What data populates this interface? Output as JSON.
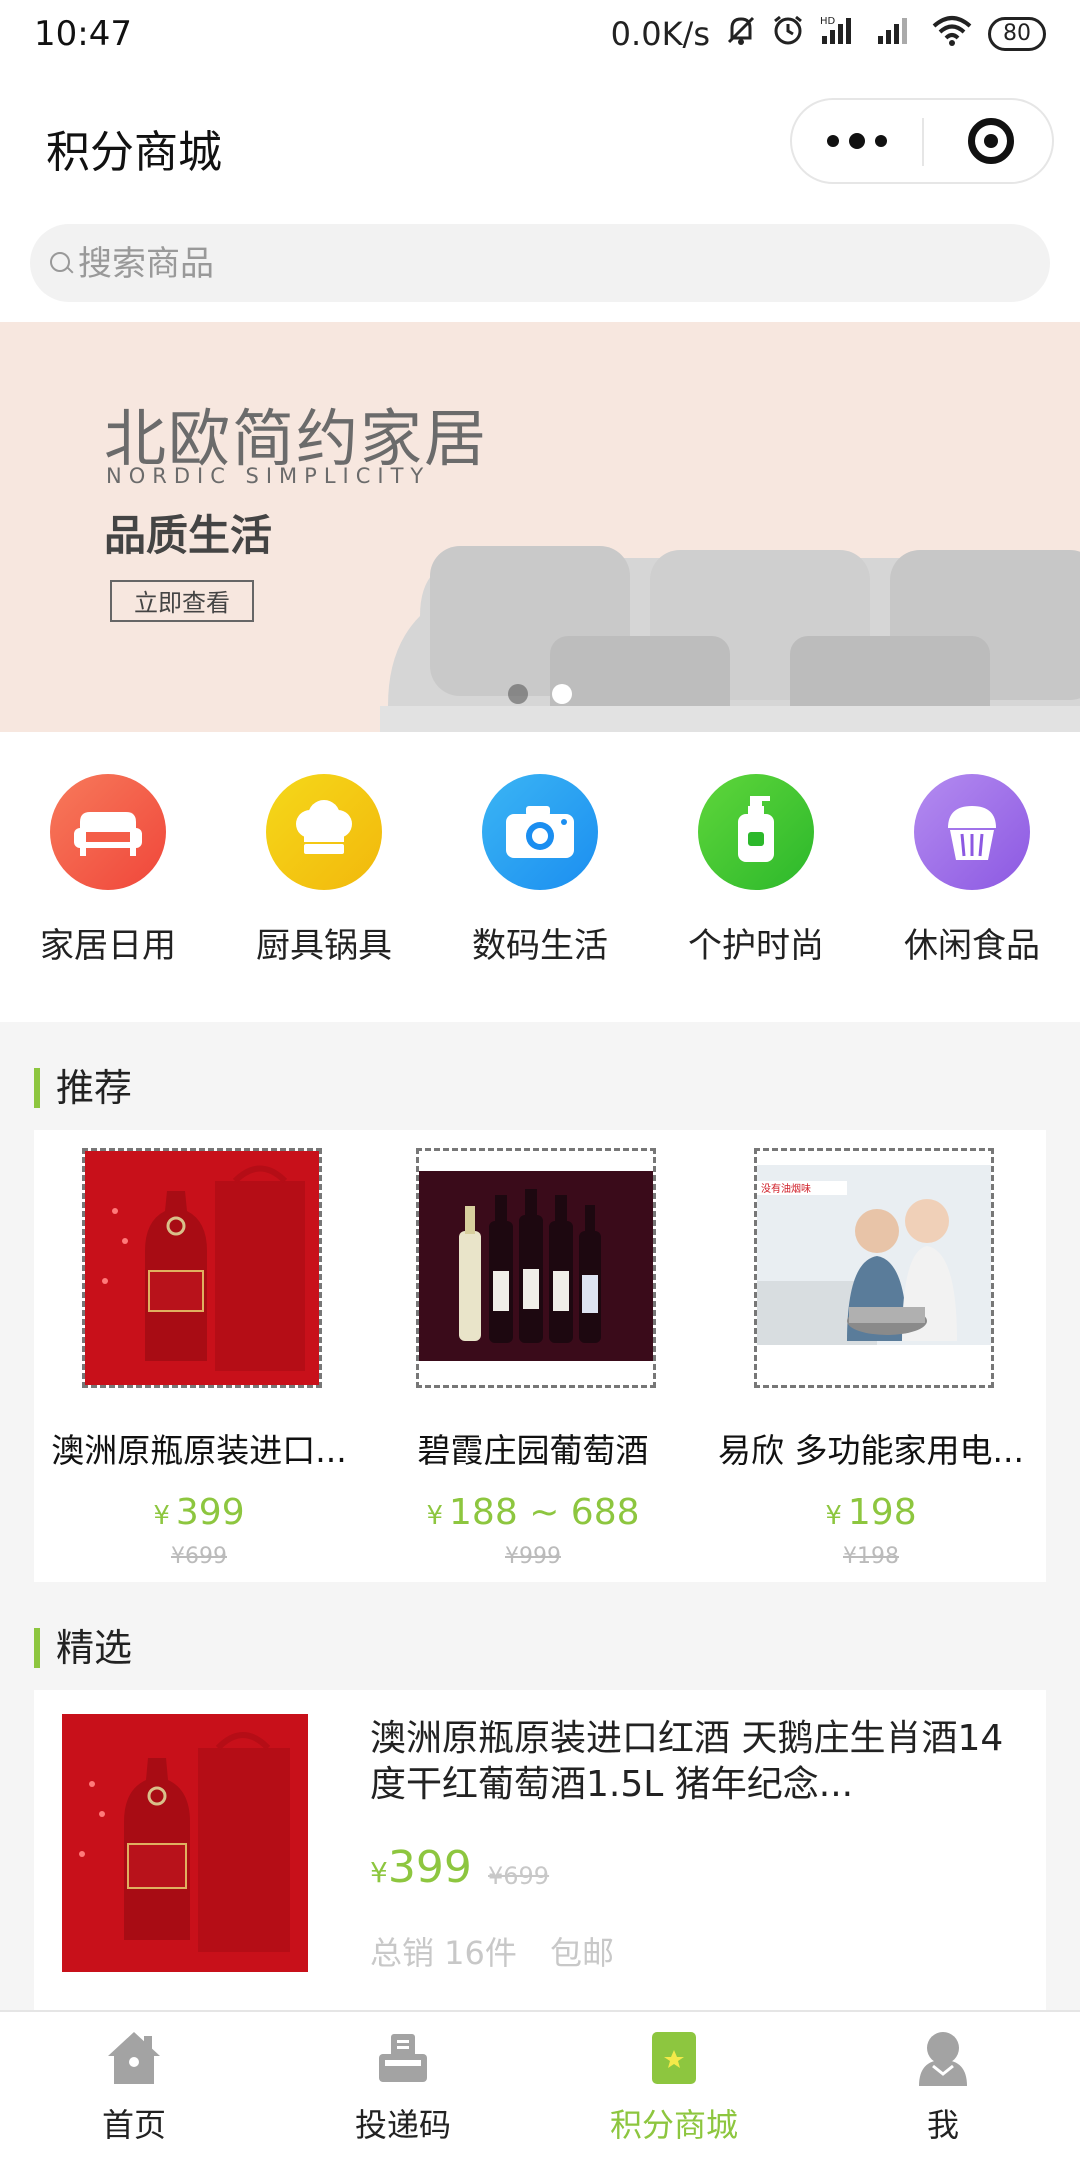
{
  "status_bar": {
    "time": "10:47",
    "speed": "0.0K/s",
    "battery": "80",
    "icons": [
      "mute-bell-icon",
      "alarm-icon",
      "signal-hd-icon",
      "signal-icon",
      "wifi-icon",
      "battery-icon"
    ]
  },
  "header": {
    "title": "积分商城",
    "capsule_icons": [
      "more-dots-icon",
      "close-target-icon"
    ]
  },
  "search": {
    "placeholder": "搜索商品"
  },
  "banner": {
    "title": "北欧简约家居",
    "subtitle": "NORDIC SIMPLICITY",
    "slogan": "品质生活",
    "button": "立即查看",
    "slides": 2,
    "active_slide": 2
  },
  "categories": [
    {
      "label": "家居日用",
      "icon": "sofa-icon",
      "color": "#f0463a"
    },
    {
      "label": "厨具锅具",
      "icon": "chef-hat-icon",
      "color": "#f2b80c"
    },
    {
      "label": "数码生活",
      "icon": "camera-icon",
      "color": "#1b8ef0"
    },
    {
      "label": "个护时尚",
      "icon": "pump-bottle-icon",
      "color": "#2cb82b"
    },
    {
      "label": "休闲食品",
      "icon": "cupcake-icon",
      "color": "#8c58e2"
    }
  ],
  "recommend": {
    "title": "推荐",
    "items": [
      {
        "name": "澳洲原瓶原装进口...",
        "yen": "¥",
        "price": "399",
        "orig": "¥699"
      },
      {
        "name": "碧霞庄园葡萄酒",
        "yen": "¥",
        "price": "188 ~ 688",
        "orig": "¥999"
      },
      {
        "name": "易欣 多功能家用电...",
        "yen": "¥",
        "price": "198",
        "orig": "¥198"
      }
    ]
  },
  "featured": {
    "title": "精选",
    "item": {
      "name": "澳洲原瓶原装进口红酒 天鹅庄生肖酒14度干红葡萄酒1.5L 猪年纪念...",
      "yen": "¥",
      "price": "399",
      "orig": "¥699",
      "sales": "总销 16件",
      "shipping": "包邮"
    }
  },
  "tabbar": [
    {
      "label": "首页",
      "icon": "home-icon",
      "active": false
    },
    {
      "label": "投递码",
      "icon": "parcel-code-icon",
      "active": false
    },
    {
      "label": "积分商城",
      "icon": "points-mall-icon",
      "active": true
    },
    {
      "label": "我",
      "icon": "user-icon",
      "active": false
    }
  ],
  "colors": {
    "accent": "#8dc63f",
    "banner_bg": "#f7e7df",
    "page_bg": "#f5f5f5"
  }
}
